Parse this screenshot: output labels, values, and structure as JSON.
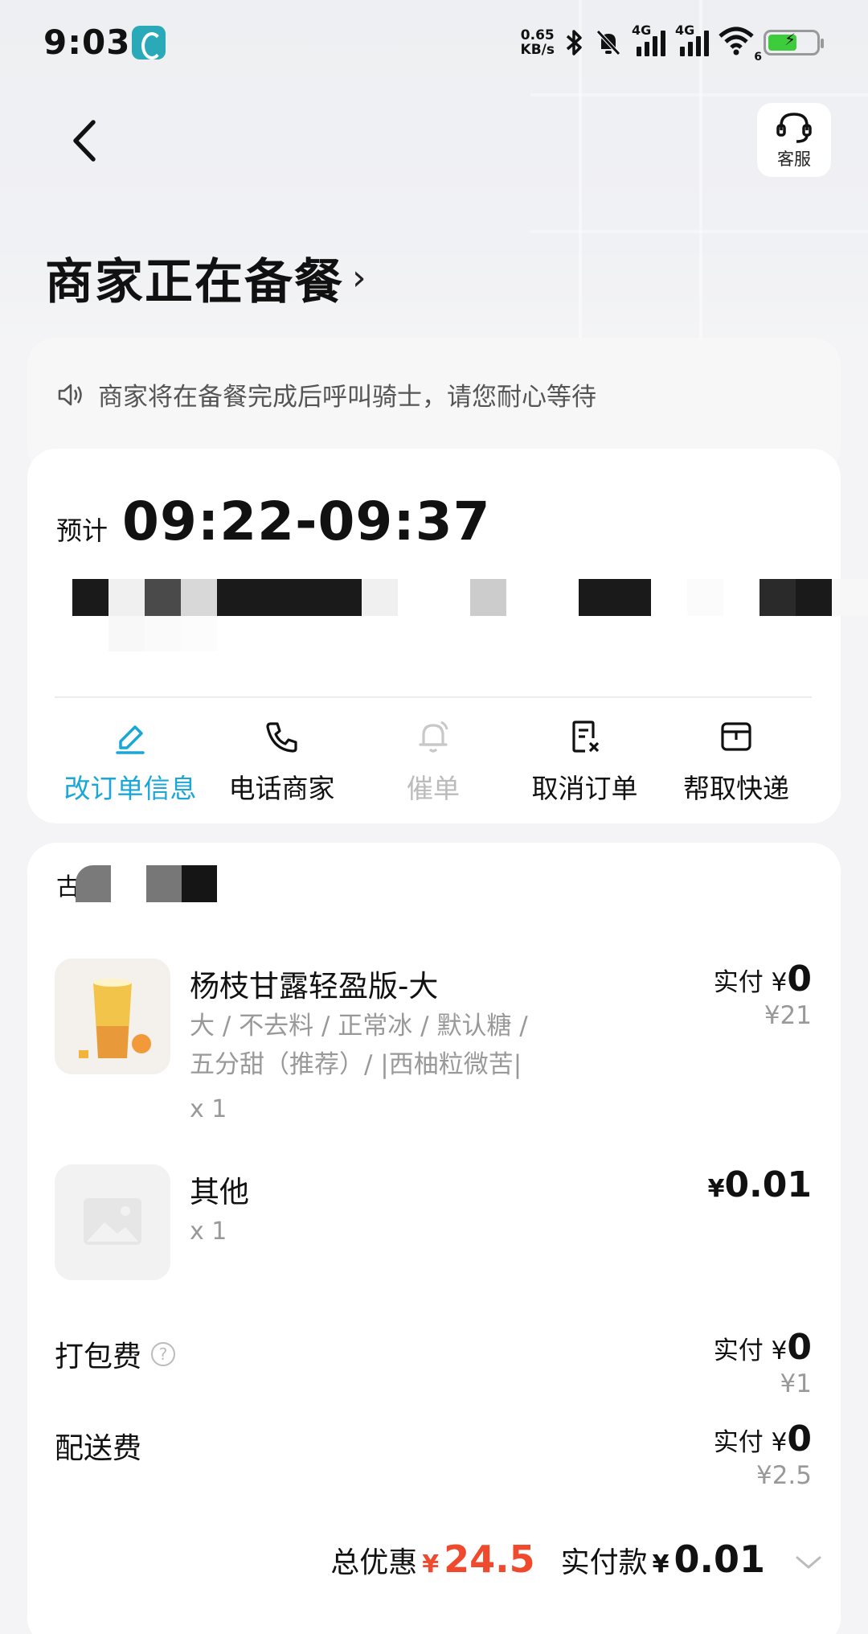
{
  "status_bar": {
    "time": "9:03",
    "net_speed_value": "0.65",
    "net_speed_unit": "KB/s",
    "signal1_label": "4G",
    "signal2_label": "4G",
    "wifi_label": "6"
  },
  "header": {
    "customer_service_label": "客服",
    "title": "商家正在备餐",
    "title_chevron": "›"
  },
  "notice": {
    "text": "商家将在备餐完成后呼叫骑士，请您耐心等待"
  },
  "eta": {
    "label": "预计",
    "time_range": "09:22-09:37"
  },
  "actions": [
    {
      "label": "改订单信息",
      "icon": "edit-icon",
      "state": "active"
    },
    {
      "label": "电话商家",
      "icon": "phone-icon",
      "state": "normal"
    },
    {
      "label": "催单",
      "icon": "bell-icon",
      "state": "disabled"
    },
    {
      "label": "取消订单",
      "icon": "cancel-order-icon",
      "state": "normal"
    },
    {
      "label": "帮取快递",
      "icon": "package-icon",
      "state": "normal"
    }
  ],
  "store": {
    "name_visible_char": "古"
  },
  "items": [
    {
      "name": "杨枝甘露轻盈版-大",
      "specs_line1": "大 / 不去料 / 正常冰 / 默认糖 /",
      "specs_line2": "五分甜（推荐）/ |西柚粒微苦|",
      "qty": "x 1",
      "paid_label": "实付 ¥",
      "paid_value": "0",
      "original_price": "¥21"
    },
    {
      "name": "其他",
      "qty": "x 1",
      "price_yen": "¥",
      "price_value": "0.01"
    }
  ],
  "fees": [
    {
      "label": "打包费",
      "has_help": true,
      "help_glyph": "?",
      "paid_label": "实付 ¥",
      "paid_value": "0",
      "original_price": "¥1"
    },
    {
      "label": "配送费",
      "has_help": false,
      "paid_label": "实付 ¥",
      "paid_value": "0",
      "original_price": "¥2.5"
    }
  ],
  "totals": {
    "discount_label": "总优惠",
    "discount_yen": "¥",
    "discount_value": "24.5",
    "paid_label": "实付款",
    "paid_yen": "¥",
    "paid_value": "0.01"
  },
  "colors": {
    "accent_blue": "#1aa7d7",
    "discount_red": "#f04a2e",
    "battery_green": "#3ccc3c"
  }
}
